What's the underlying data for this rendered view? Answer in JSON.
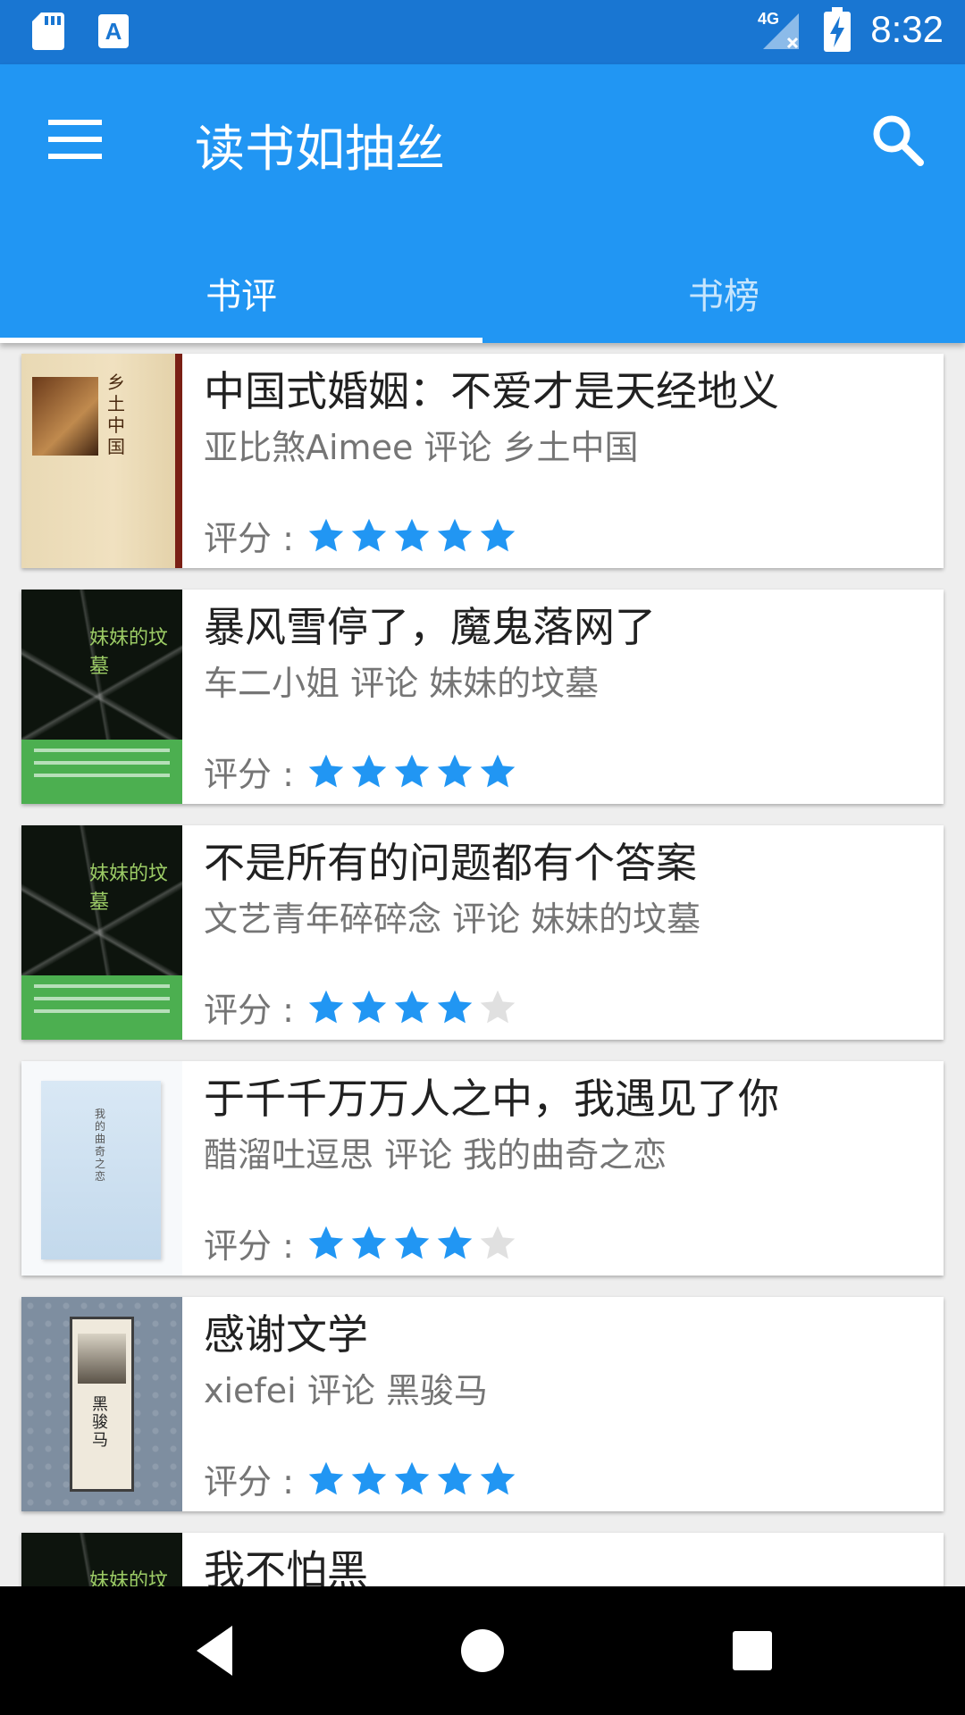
{
  "status_bar": {
    "time": "8:32",
    "network": "4G",
    "icons": [
      "sd-card-icon",
      "text-a-icon",
      "signal-4g-icon",
      "battery-charging-icon"
    ]
  },
  "app_bar": {
    "title": "读书如抽丝",
    "menu_icon": "menu-icon",
    "search_icon": "search-icon"
  },
  "tabs": [
    {
      "label": "书评",
      "active": true
    },
    {
      "label": "书榜",
      "active": false
    }
  ],
  "colors": {
    "primary": "#2196f3",
    "primary_dark": "#1976d2",
    "star_on": "#2196f3",
    "star_off": "#e0e0e0"
  },
  "rating_label": "评分 :",
  "reviews": [
    {
      "title": "中国式婚姻：不爱才是天经地义",
      "subtitle": "亚比煞Aimee 评论 乡土中国",
      "rating": 5,
      "cover_text": "乡土中国"
    },
    {
      "title": "暴风雪停了，魔鬼落网了",
      "subtitle": "车二小姐 评论 妹妹的坟墓",
      "rating": 5,
      "cover_text": "妹妹的坟墓"
    },
    {
      "title": "不是所有的问题都有个答案",
      "subtitle": "文艺青年碎碎念 评论 妹妹的坟墓",
      "rating": 4,
      "cover_text": "妹妹的坟墓"
    },
    {
      "title": "于千千万万人之中，我遇见了你",
      "subtitle": "醋溜吐逗思 评论 我的曲奇之恋",
      "rating": 4,
      "cover_text": "我的曲奇之恋"
    },
    {
      "title": "感谢文学",
      "subtitle": "xiefei 评论 黑骏马",
      "rating": 5,
      "cover_text": "黑骏马"
    },
    {
      "title": "我不怕黑",
      "subtitle": "",
      "rating": 0,
      "cover_text": "妹妹的坟墓"
    }
  ],
  "nav_bar": {
    "icons": [
      "back-icon",
      "home-icon",
      "recents-icon"
    ]
  }
}
